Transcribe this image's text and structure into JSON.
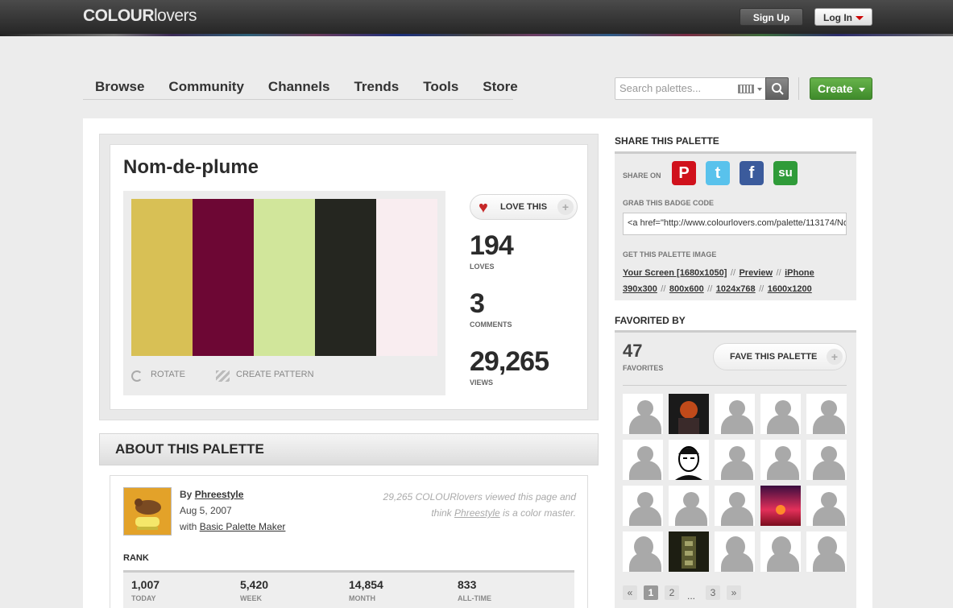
{
  "header": {
    "logo_bold": "COLOUR",
    "logo_light": "lovers",
    "signup_label": "Sign Up",
    "login_label": "Log In"
  },
  "nav": {
    "items": [
      "Browse",
      "Community",
      "Channels",
      "Trends",
      "Tools",
      "Store"
    ]
  },
  "search": {
    "placeholder": "Search palettes..."
  },
  "create": {
    "label": "Create"
  },
  "palette": {
    "title": "Nom-de-plume",
    "colors": [
      "#d8c055",
      "#6d0734",
      "#d1e69b",
      "#252620",
      "#f9edf0"
    ],
    "rotate_label": "ROTATE",
    "pattern_label": "CREATE PATTERN",
    "love_label": "LOVE THIS",
    "loves": "194",
    "loves_label": "LOVES",
    "comments": "3",
    "comments_label": "COMMENTS",
    "views": "29,265",
    "views_label": "VIEWS"
  },
  "about": {
    "title": "ABOUT THIS PALETTE",
    "by_prefix": "By",
    "author": "Phreestyle",
    "date": "Aug 5, 2007",
    "with_prefix": "with",
    "tool": "Basic Palette Maker",
    "viewed_line1": "29,265 COLOURlovers viewed this page and",
    "viewed_line2_pre": "think",
    "viewed_line2_author": "Phreestyle",
    "viewed_line2_post": "is a color master.",
    "rank_label": "RANK",
    "ranks": [
      {
        "value": "1,007",
        "label": "TODAY"
      },
      {
        "value": "5,420",
        "label": "WEEK"
      },
      {
        "value": "14,854",
        "label": "MONTH"
      },
      {
        "value": "833",
        "label": "ALL-TIME"
      }
    ]
  },
  "share": {
    "title": "SHARE THIS PALETTE",
    "share_on": "SHARE ON",
    "icons": [
      "pinterest-icon",
      "twitter-icon",
      "facebook-icon",
      "stumbleupon-icon"
    ],
    "badge_label": "GRAB THIS BADGE CODE",
    "badge_code": "<a href=\"http://www.colourlovers.com/palette/113174/No",
    "image_label": "GET THIS PALETTE IMAGE",
    "links_row1": [
      "Your Screen [1680x1050]",
      "Preview",
      "iPhone"
    ],
    "links_row2": [
      "390x300",
      "800x600",
      "1024x768",
      "1600x1200"
    ],
    "separator": "//"
  },
  "favorited": {
    "title": "FAVORITED BY",
    "count": "47",
    "count_label": "FAVORITES",
    "fave_label": "FAVE THIS PALETTE",
    "pages": [
      "«",
      "1",
      "2",
      "...",
      "3",
      "»"
    ]
  }
}
